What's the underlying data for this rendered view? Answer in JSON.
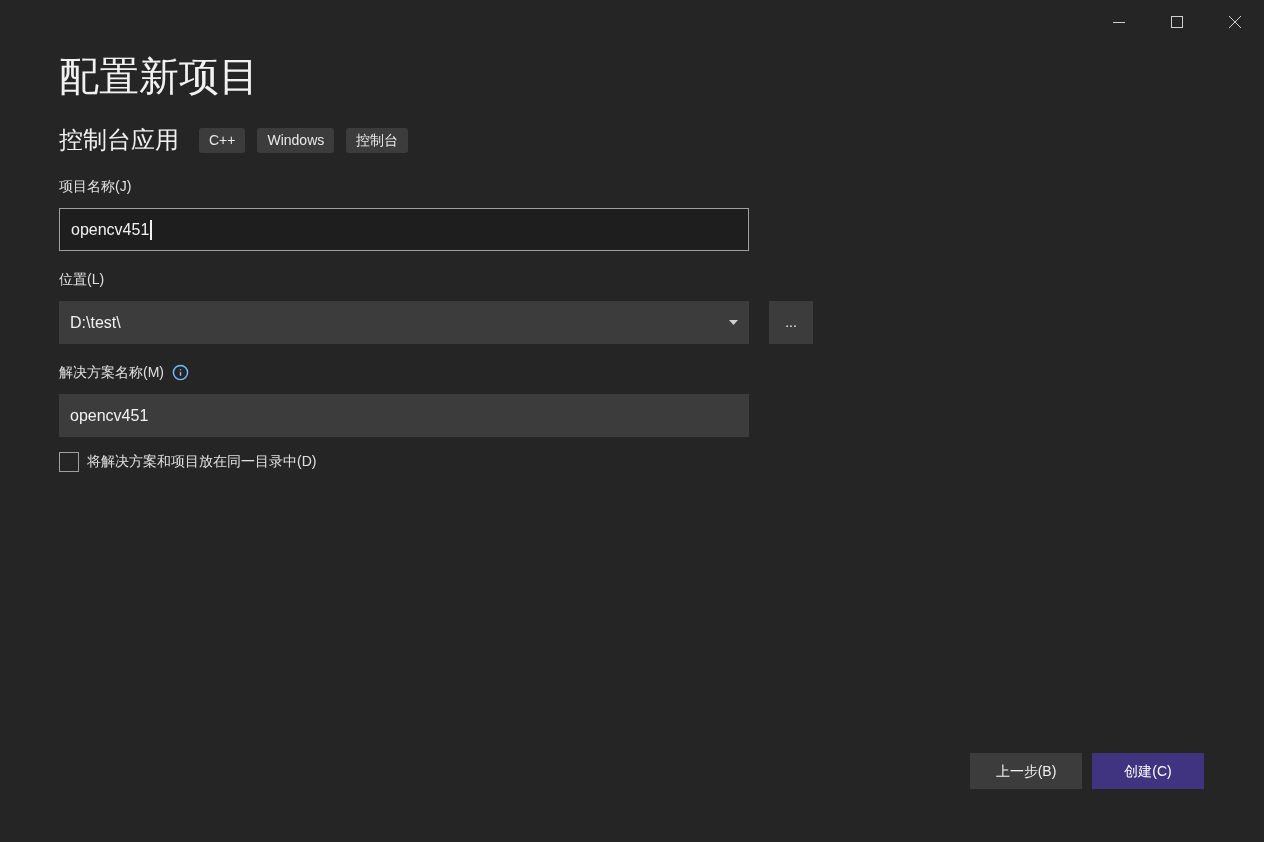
{
  "title": "配置新项目",
  "template": {
    "name": "控制台应用",
    "tags": [
      "C++",
      "Windows",
      "控制台"
    ]
  },
  "fields": [
    {
      "kind": "text",
      "label": "项目名称(J)",
      "value": "opencv451",
      "focused": true,
      "info": false
    },
    {
      "kind": "dropdown",
      "label": "位置(L)",
      "value": "D:\\test\\",
      "focused": false,
      "info": false,
      "browse": "..."
    },
    {
      "kind": "text",
      "label": "解决方案名称(M)",
      "value": "opencv451",
      "focused": false,
      "info": true
    }
  ],
  "checkbox": {
    "label": "将解决方案和项目放在同一目录中(D)",
    "checked": false
  },
  "buttons": [
    {
      "label": "上一步(B)",
      "kind": "secondary"
    },
    {
      "label": "创建(C)",
      "kind": "primary"
    }
  ]
}
